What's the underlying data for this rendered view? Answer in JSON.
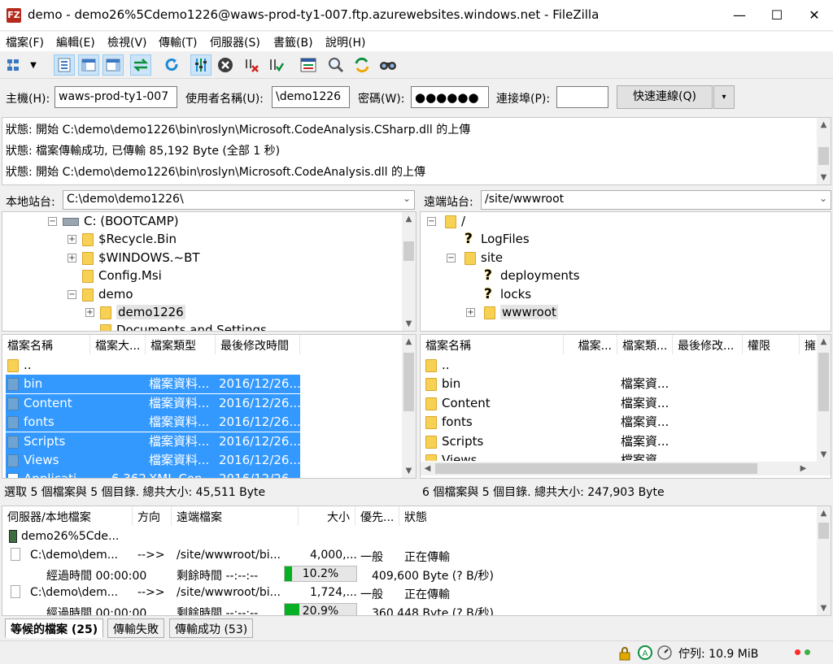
{
  "window": {
    "title": "demo - demo26%5Cdemo1226@waws-prod-ty1-007.ftp.azurewebsites.windows.net - FileZilla",
    "app_icon": "FZ"
  },
  "menu": [
    "檔案(F)",
    "編輯(E)",
    "檢視(V)",
    "傳輸(T)",
    "伺服器(S)",
    "書籤(B)",
    "說明(H)"
  ],
  "quickconnect": {
    "host_label": "主機(H):",
    "host_value": "waws-prod-ty1-007",
    "user_label": "使用者名稱(U):",
    "user_value": "\\demo1226",
    "pass_label": "密碼(W):",
    "pass_value": "●●●●●●",
    "port_label": "連接埠(P):",
    "port_value": "",
    "connect_button": "快速連線(Q)",
    "dropdown": "▾"
  },
  "log": [
    "狀態: 開始 C:\\demo\\demo1226\\bin\\roslyn\\Microsoft.CodeAnalysis.CSharp.dll 的上傳",
    "狀態: 檔案傳輸成功, 已傳輸 85,192 Byte (全部 1 秒)",
    "狀態: 開始 C:\\demo\\demo1226\\bin\\roslyn\\Microsoft.CodeAnalysis.dll 的上傳"
  ],
  "local": {
    "site_label": "本地站台:",
    "site_path": "C:\\demo\\demo1226\\",
    "tree": [
      {
        "label": "C: (BOOTCAMP)",
        "expander": "−"
      },
      {
        "label": "$Recycle.Bin",
        "expander": "+"
      },
      {
        "label": "$WINDOWS.~BT",
        "expander": "+"
      },
      {
        "label": "Config.Msi",
        "expander": ""
      },
      {
        "label": "demo",
        "expander": "−"
      },
      {
        "label": "demo1226",
        "expander": "+"
      },
      {
        "label": "Documents and Settings",
        "expander": ""
      }
    ],
    "headers": [
      "檔案名稱",
      "檔案大...",
      "檔案類型",
      "最後修改時間"
    ],
    "files": [
      {
        "name": "..",
        "size": "",
        "type": "",
        "modified": ""
      },
      {
        "name": "bin",
        "size": "",
        "type": "檔案資料...",
        "modified": "2016/12/26..."
      },
      {
        "name": "Content",
        "size": "",
        "type": "檔案資料...",
        "modified": "2016/12/26..."
      },
      {
        "name": "fonts",
        "size": "",
        "type": "檔案資料...",
        "modified": "2016/12/26..."
      },
      {
        "name": "Scripts",
        "size": "",
        "type": "檔案資料...",
        "modified": "2016/12/26..."
      },
      {
        "name": "Views",
        "size": "",
        "type": "檔案資料...",
        "modified": "2016/12/26..."
      },
      {
        "name": "Applicati...",
        "size": "6,362",
        "type": "XML Con...",
        "modified": "2016/12/26..."
      }
    ],
    "status": "選取 5 個檔案與 5 個目錄. 總共大小: 45,511 Byte"
  },
  "remote": {
    "site_label": "遠端站台:",
    "site_path": "/site/wwwroot",
    "tree": [
      {
        "label": "/",
        "expander": "−",
        "icon": "folder"
      },
      {
        "label": "LogFiles",
        "expander": "",
        "icon": "question"
      },
      {
        "label": "site",
        "expander": "−",
        "icon": "folder"
      },
      {
        "label": "deployments",
        "expander": "",
        "icon": "question"
      },
      {
        "label": "locks",
        "expander": "",
        "icon": "question"
      },
      {
        "label": "wwwroot",
        "expander": "+",
        "icon": "folder"
      }
    ],
    "headers": [
      "檔案名稱",
      "檔案...",
      "檔案類...",
      "最後修改...",
      "權限",
      "擁"
    ],
    "files": [
      {
        "name": "..",
        "type": ""
      },
      {
        "name": "bin",
        "type": "檔案資..."
      },
      {
        "name": "Content",
        "type": "檔案資..."
      },
      {
        "name": "fonts",
        "type": "檔案資..."
      },
      {
        "name": "Scripts",
        "type": "檔案資..."
      },
      {
        "name": "Views",
        "type": "檔案資..."
      }
    ],
    "status": "6 個檔案與 5 個目錄. 總共大小: 247,903 Byte"
  },
  "queue": {
    "headers": [
      "伺服器/本地檔案",
      "方向",
      "遠端檔案",
      "大小",
      "優先...",
      "狀態"
    ],
    "server": "demo26%5Cde...",
    "items": [
      {
        "local": "C:\\demo\\dem...",
        "direction": "-->>",
        "remote": "/site/wwwroot/bi...",
        "size": "4,000,...",
        "priority": "一般",
        "status": "正在傳輸",
        "elapsed": "經過時間 00:00:00",
        "remaining": "剩餘時間 --:--:--",
        "progress": 10.2,
        "progress_label": "10.2%",
        "rate": "409,600 Byte (? B/秒)"
      },
      {
        "local": "C:\\demo\\dem...",
        "direction": "-->>",
        "remote": "/site/wwwroot/bi...",
        "size": "1,724,...",
        "priority": "一般",
        "status": "正在傳輸",
        "elapsed": "經過時間 00:00:00",
        "remaining": "剩餘時間 --:--:--",
        "progress": 20.9,
        "progress_label": "20.9%",
        "rate": "360,448 Byte (? B/秒)"
      }
    ]
  },
  "tabs": [
    "等候的檔案 (25)",
    "傳輸失敗",
    "傳輸成功 (53)"
  ],
  "statusbar": {
    "queue_label": "佇列: 10.9 MiB"
  },
  "colors": {
    "selection": "#3399ff",
    "progress": "#06b025",
    "folder": "#f7d154"
  }
}
